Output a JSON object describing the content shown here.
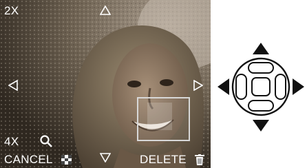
{
  "screen": {
    "zoom_top": "2X",
    "zoom_bottom": "4X",
    "cancel_label": "CANCEL",
    "delete_label": "DELETE",
    "icons": {
      "up": "triangle-up-outline-icon",
      "down": "triangle-down-outline-icon",
      "left": "triangle-left-outline-icon",
      "right": "triangle-right-outline-icon",
      "magnify": "magnifier-icon",
      "mosaic": "checkerboard-icon",
      "trash": "trash-icon"
    }
  },
  "dial": {
    "icons": [
      "cursor-up-arrow-icon",
      "cursor-down-arrow-icon",
      "cursor-left-arrow-icon",
      "cursor-right-arrow-icon"
    ]
  },
  "colors": {
    "osd_text": "#ffffff",
    "dial": "#111111"
  }
}
